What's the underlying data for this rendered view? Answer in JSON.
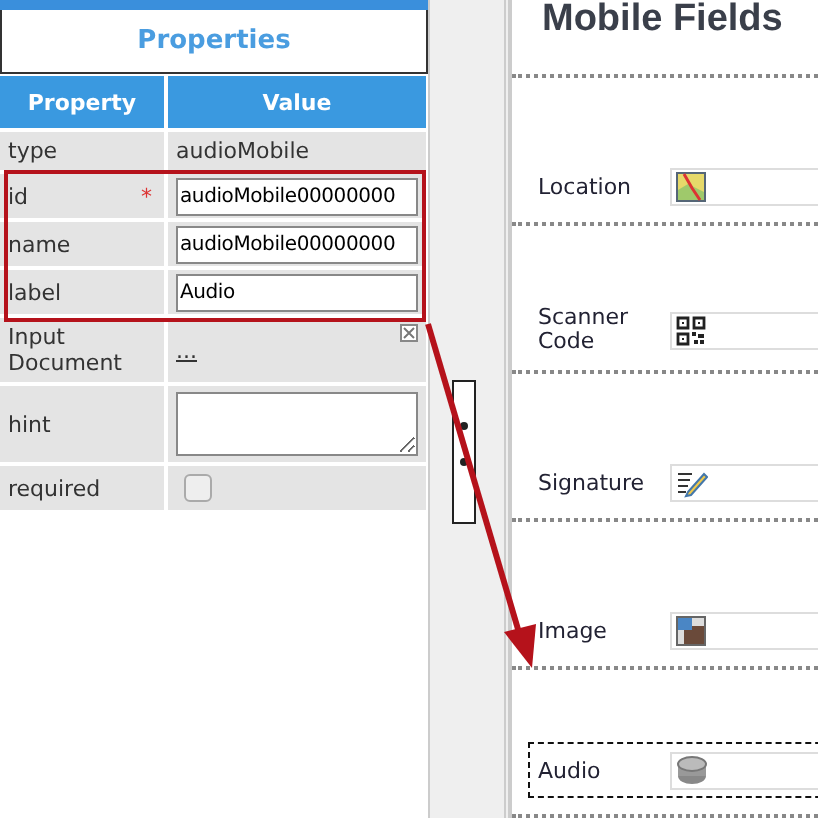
{
  "properties": {
    "title": "Properties",
    "columns": [
      "Property",
      "Value"
    ],
    "rows": [
      {
        "name": "type",
        "kind": "text",
        "value": "audioMobile"
      },
      {
        "name": "id",
        "kind": "input",
        "value": "audioMobile00000000",
        "required_mark": "*"
      },
      {
        "name": "name",
        "kind": "input",
        "value": "audioMobile00000000"
      },
      {
        "name": "label",
        "kind": "input",
        "value": "Audio"
      },
      {
        "name": "Input Document",
        "kind": "document",
        "value": "..."
      },
      {
        "name": "hint",
        "kind": "textarea"
      },
      {
        "name": "required",
        "kind": "checkbox",
        "checked": false
      }
    ]
  },
  "mobile_form": {
    "title": "Mobile Fields",
    "fields": [
      {
        "label": "Location",
        "kind": "location",
        "selected": false
      },
      {
        "label": "Scanner Code",
        "kind": "scanner",
        "selected": false
      },
      {
        "label": "Signature",
        "kind": "signature",
        "selected": false
      },
      {
        "label": "Image",
        "kind": "image",
        "selected": false
      },
      {
        "label": "Audio",
        "kind": "audio",
        "selected": true
      }
    ]
  }
}
